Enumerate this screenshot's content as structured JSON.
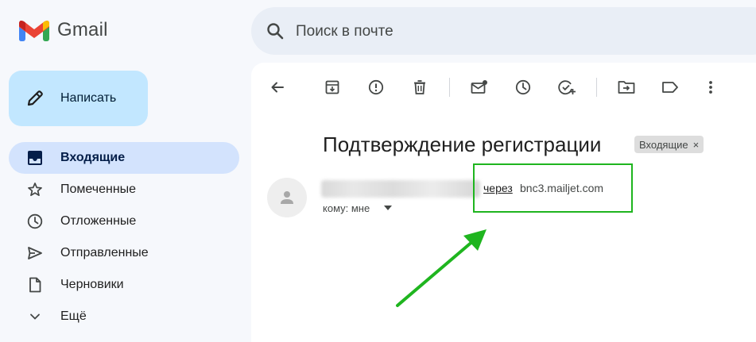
{
  "app": {
    "name": "Gmail"
  },
  "search": {
    "placeholder": "Поиск в почте"
  },
  "compose": {
    "label": "Написать"
  },
  "sidebar": {
    "items": [
      {
        "label": "Входящие",
        "icon": "inbox-icon",
        "active": true
      },
      {
        "label": "Помеченные",
        "icon": "star-icon"
      },
      {
        "label": "Отложенные",
        "icon": "clock-icon"
      },
      {
        "label": "Отправленные",
        "icon": "send-icon"
      },
      {
        "label": "Черновики",
        "icon": "draft-icon"
      },
      {
        "label": "Ещё",
        "icon": "chevron-down-icon"
      }
    ]
  },
  "toolbar": {
    "icons": [
      "back-icon",
      "archive-icon",
      "report-spam-icon",
      "delete-icon",
      "mark-unread-icon",
      "snooze-icon",
      "add-task-icon",
      "move-to-icon",
      "label-icon",
      "more-icon"
    ]
  },
  "email": {
    "subject": "Подтверждение регистрации",
    "label_chip": "Входящие",
    "label_remove": "×",
    "via_label": "через",
    "via_domain": "bnc3.mailjet.com",
    "to_line": "кому: мне"
  },
  "colors": {
    "compose_bg": "#c2e7ff",
    "active_nav_bg": "#d3e3fd",
    "annotation_green": "#1fb51f"
  }
}
